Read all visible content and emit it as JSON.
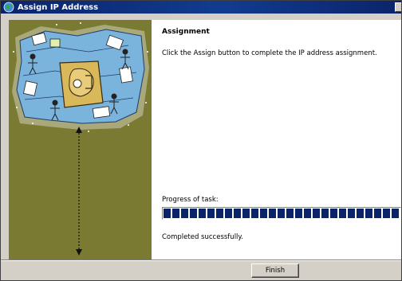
{
  "window": {
    "title": "Assign IP Address"
  },
  "wizard": {
    "heading": "Assignment",
    "instruction": "Click the Assign button to complete the IP address assignment.",
    "progress_label": "Progress of task:",
    "progress_fraction": 1.0,
    "status_text": "Completed successfully."
  },
  "buttons": {
    "finish_label": "Finish"
  },
  "colors": {
    "titlebar": "#0a246a",
    "side_panel": "#7a7a33",
    "progress_fill": "#0a246a",
    "dialog_face": "#d4d0c8"
  },
  "icons": {
    "app": "globe-network-icon",
    "close": "close-icon",
    "illustration": "wizard-collage-illustration"
  }
}
